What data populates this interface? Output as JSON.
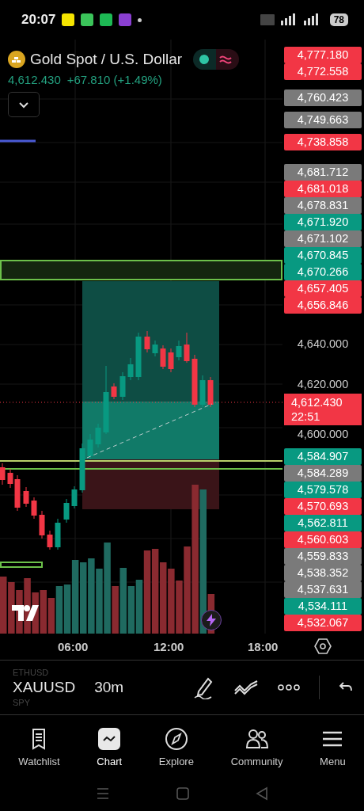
{
  "status_bar": {
    "time": "20:07",
    "battery": "78"
  },
  "symbol_header": {
    "title": "Gold Spot / U.S. Dollar",
    "price": "4,612.430",
    "change": "+67.810 (+1.49%)",
    "market_toggle": {
      "on": true
    }
  },
  "price_scale": {
    "labels": [
      {
        "text": "4,777.180",
        "kind": "red"
      },
      {
        "text": "4,772.558",
        "kind": "red"
      },
      {
        "text": "4,760.423",
        "kind": "grey"
      },
      {
        "text": "4,749.663",
        "kind": "grey"
      },
      {
        "text": "4,738.858",
        "kind": "red"
      },
      {
        "text": "4,681.712",
        "kind": "grey"
      },
      {
        "text": "4,681.018",
        "kind": "red"
      },
      {
        "text": "4,678.831",
        "kind": "grey"
      },
      {
        "text": "4,671.920",
        "kind": "green"
      },
      {
        "text": "4,671.102",
        "kind": "grey"
      },
      {
        "text": "4,670.845",
        "kind": "green"
      },
      {
        "text": "4,670.266",
        "kind": "green"
      },
      {
        "text": "4,657.405",
        "kind": "red"
      },
      {
        "text": "4,656.846",
        "kind": "red"
      },
      {
        "text": "4,640.000",
        "kind": "plain"
      },
      {
        "text": "4,620.000",
        "kind": "plain"
      },
      {
        "text": "4,600.000",
        "kind": "plain"
      },
      {
        "text": "4,584.907",
        "kind": "green"
      },
      {
        "text": "4,584.289",
        "kind": "grey"
      },
      {
        "text": "4,579.578",
        "kind": "green"
      },
      {
        "text": "4,570.693",
        "kind": "red"
      },
      {
        "text": "4,562.811",
        "kind": "green"
      },
      {
        "text": "4,560.603",
        "kind": "red"
      },
      {
        "text": "4,559.833",
        "kind": "grey"
      },
      {
        "text": "4,538.352",
        "kind": "grey"
      },
      {
        "text": "4,537.631",
        "kind": "grey"
      },
      {
        "text": "4,534.111",
        "kind": "green"
      },
      {
        "text": "4,532.067",
        "kind": "red"
      }
    ],
    "last_price": {
      "price": "4,612.430",
      "countdown": "22:51"
    }
  },
  "time_axis": {
    "labels": [
      "06:00",
      "12:00",
      "18:00"
    ]
  },
  "symbol_bar": {
    "symbols": [
      {
        "text": "ETHUSD",
        "selected": false
      },
      {
        "text": "XAUUSD",
        "selected": true
      },
      {
        "text": "SPY",
        "selected": false
      }
    ],
    "interval": "30m"
  },
  "bottom_nav": [
    {
      "label": "Watchlist",
      "selected": false
    },
    {
      "label": "Chart",
      "selected": true
    },
    {
      "label": "Explore",
      "selected": false
    },
    {
      "label": "Community",
      "selected": false
    },
    {
      "label": "Menu",
      "selected": false
    }
  ]
}
